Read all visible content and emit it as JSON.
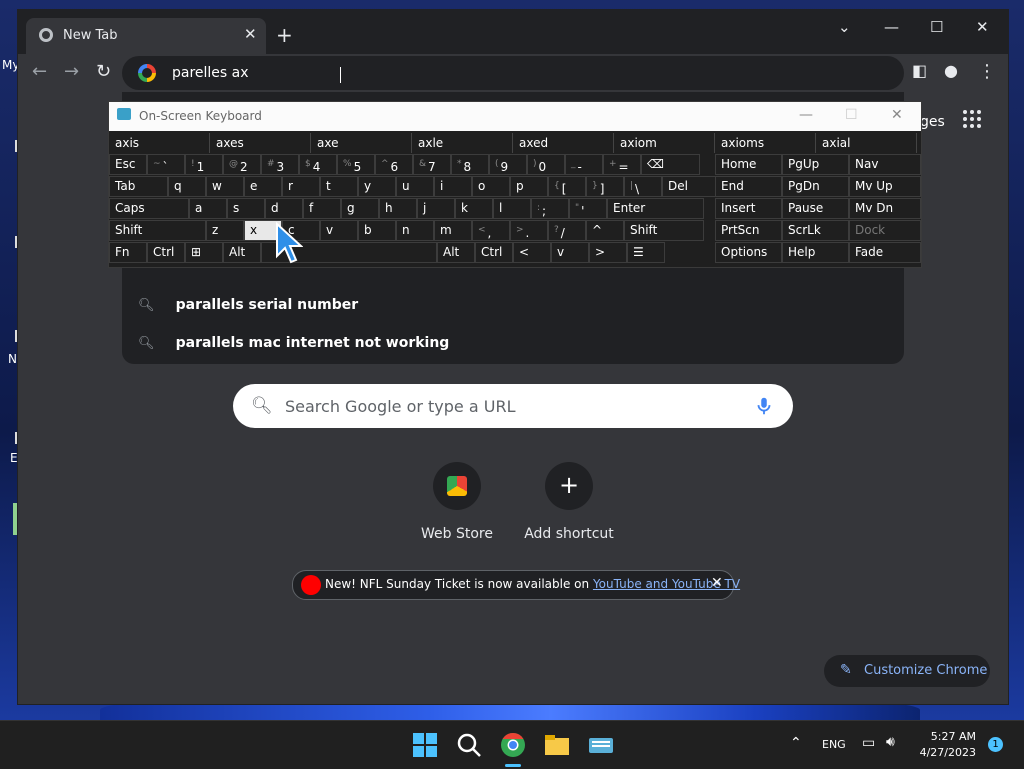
{
  "desktop": {
    "label_my": "My",
    "letters": [
      "N",
      "E"
    ]
  },
  "browser": {
    "tab_title": "New Tab",
    "omnibox_text": "parelles ax",
    "suggestions": [
      "parallels serial number",
      "parallels mac internet not working"
    ],
    "header_link_partial": "ges",
    "search_placeholder": "Search Google or type a URL",
    "shortcuts": [
      {
        "label": "Web Store",
        "icon": "web-store-icon"
      },
      {
        "label": "Add shortcut",
        "icon": "plus-icon"
      }
    ],
    "promo": {
      "text": "New! NFL Sunday Ticket is now available on ",
      "link": "YouTube and YouTube TV"
    },
    "customize_label": "Customize Chrome"
  },
  "osk": {
    "title": "On-Screen Keyboard",
    "predictions": [
      "axis",
      "axes",
      "axe",
      "axle",
      "axed",
      "axiom",
      "axioms",
      "axial"
    ],
    "rows": [
      [
        {
          "label": "Esc"
        },
        {
          "label": "`",
          "sup": "~"
        },
        {
          "label": "1",
          "sup": "!"
        },
        {
          "label": "2",
          "sup": "@"
        },
        {
          "label": "3",
          "sup": "#"
        },
        {
          "label": "4",
          "sup": "$"
        },
        {
          "label": "5",
          "sup": "%"
        },
        {
          "label": "6",
          "sup": "^"
        },
        {
          "label": "7",
          "sup": "&"
        },
        {
          "label": "8",
          "sup": "*"
        },
        {
          "label": "9",
          "sup": "("
        },
        {
          "label": "0",
          "sup": ")"
        },
        {
          "label": "-",
          "sup": "_"
        },
        {
          "label": "=",
          "sup": "+"
        },
        {
          "label": "⌫"
        }
      ],
      [
        {
          "label": "Tab"
        },
        {
          "label": "q"
        },
        {
          "label": "w"
        },
        {
          "label": "e"
        },
        {
          "label": "r"
        },
        {
          "label": "t"
        },
        {
          "label": "y"
        },
        {
          "label": "u"
        },
        {
          "label": "i"
        },
        {
          "label": "o"
        },
        {
          "label": "p"
        },
        {
          "label": "[",
          "sup": "{"
        },
        {
          "label": "]",
          "sup": "}"
        },
        {
          "label": "\\",
          "sup": "|"
        },
        {
          "label": "Del"
        }
      ],
      [
        {
          "label": "Caps"
        },
        {
          "label": "a"
        },
        {
          "label": "s"
        },
        {
          "label": "d"
        },
        {
          "label": "f"
        },
        {
          "label": "g"
        },
        {
          "label": "h"
        },
        {
          "label": "j"
        },
        {
          "label": "k"
        },
        {
          "label": "l"
        },
        {
          "label": ";",
          "sup": ":"
        },
        {
          "label": "'",
          "sup": "\""
        },
        {
          "label": "Enter"
        }
      ],
      [
        {
          "label": "Shift"
        },
        {
          "label": "z"
        },
        {
          "label": "x"
        },
        {
          "label": "c"
        },
        {
          "label": "v"
        },
        {
          "label": "b"
        },
        {
          "label": "n"
        },
        {
          "label": "m"
        },
        {
          "label": ",",
          "sup": "<"
        },
        {
          "label": ".",
          "sup": ">"
        },
        {
          "label": "/",
          "sup": "?"
        },
        {
          "label": "^"
        },
        {
          "label": "Shift"
        }
      ],
      [
        {
          "label": "Fn"
        },
        {
          "label": "Ctrl"
        },
        {
          "label": "⊞"
        },
        {
          "label": "Alt"
        },
        {
          "label": ""
        },
        {
          "label": "Alt"
        },
        {
          "label": "Ctrl"
        },
        {
          "label": "<"
        },
        {
          "label": "v"
        },
        {
          "label": ">"
        },
        {
          "label": "☰"
        }
      ]
    ],
    "nav_keys": [
      [
        "Home",
        "PgUp",
        "Nav"
      ],
      [
        "End",
        "PgDn",
        "Mv Up"
      ],
      [
        "Insert",
        "Pause",
        "Mv Dn"
      ],
      [
        "PrtScn",
        "ScrLk",
        "Dock"
      ],
      [
        "Options",
        "Help",
        "Fade"
      ]
    ],
    "highlighted_key": "x"
  },
  "taskbar": {
    "language": "ENG",
    "time": "5:27 AM",
    "date": "4/27/2023",
    "notification_count": "1"
  }
}
